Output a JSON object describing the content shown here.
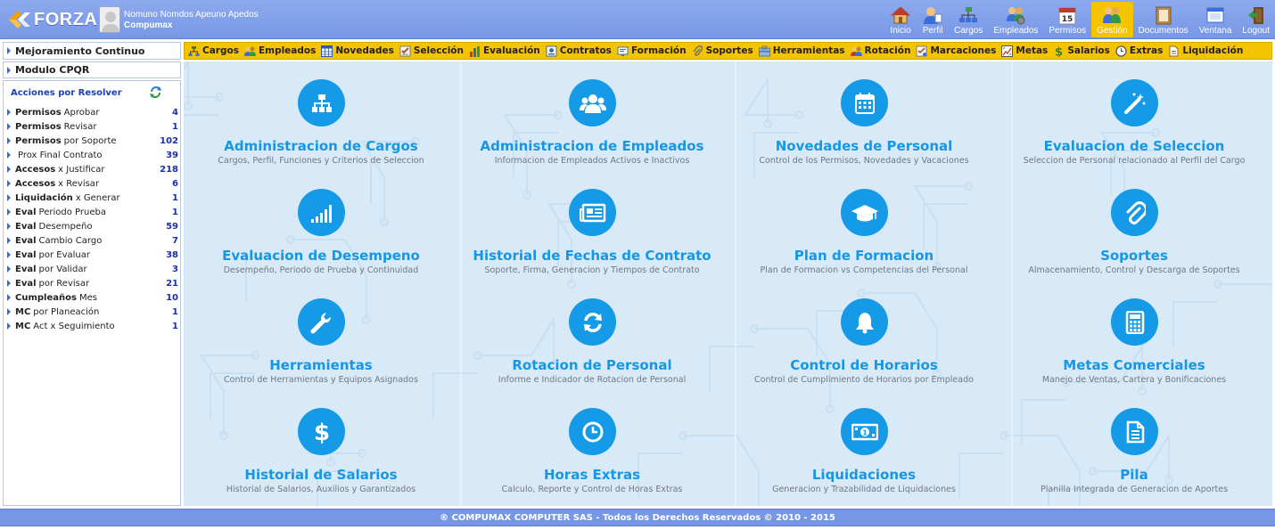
{
  "header": {
    "brand": "FORZA",
    "user_name": "Nomuno Nomdos Apeuno Apedos",
    "company": "Compumax",
    "nav": [
      {
        "label": "Inicio",
        "icon": "home-icon"
      },
      {
        "label": "Perfil",
        "icon": "user-profile-icon"
      },
      {
        "label": "Cargos",
        "icon": "org-chart-icon"
      },
      {
        "label": "Empleados",
        "icon": "employees-icon"
      },
      {
        "label": "Permisos",
        "icon": "calendar-icon"
      },
      {
        "label": "Gestión",
        "icon": "people-management-icon",
        "active": true
      },
      {
        "label": "Documentos",
        "icon": "documents-icon"
      },
      {
        "label": "Ventana",
        "icon": "window-icon"
      },
      {
        "label": "Logout",
        "icon": "logout-icon"
      }
    ]
  },
  "sidebar": {
    "mejoramiento": "Mejoramiento Continuo",
    "modulo": "Modulo CPQR",
    "acciones_title": "Acciones por Resolver",
    "items": [
      {
        "bold": "Permisos",
        "text": "Aprobar",
        "count": "4"
      },
      {
        "bold": "Permisos",
        "text": "Revisar",
        "count": "1"
      },
      {
        "bold": "Permisos",
        "text": "por Soporte",
        "count": "102"
      },
      {
        "bold": "",
        "text": "Prox Final Contrato",
        "count": "39"
      },
      {
        "bold": "Accesos",
        "text": "x Justificar",
        "count": "218"
      },
      {
        "bold": "Accesos",
        "text": "x Revisar",
        "count": "6"
      },
      {
        "bold": "Liquidación",
        "text": "x Generar",
        "count": "1"
      },
      {
        "bold": "Eval",
        "text": "Periodo Prueba",
        "count": "1"
      },
      {
        "bold": "Eval",
        "text": "Desempeño",
        "count": "59"
      },
      {
        "bold": "Eval",
        "text": "Cambio Cargo",
        "count": "7"
      },
      {
        "bold": "Eval",
        "text": "por Evaluar",
        "count": "38"
      },
      {
        "bold": "Eval",
        "text": "por Validar",
        "count": "3"
      },
      {
        "bold": "Eval",
        "text": "por Revisar",
        "count": "21"
      },
      {
        "bold": "Cumpleaños",
        "text": "Mes",
        "count": "10"
      },
      {
        "bold": "MC",
        "text": "por Planeación",
        "count": "1"
      },
      {
        "bold": "MC",
        "text": "Act x Seguimiento",
        "count": "1"
      }
    ]
  },
  "modules": [
    {
      "label": "Cargos",
      "icon": "org-chart-icon",
      "color": "#3c7d3c"
    },
    {
      "label": "Empleados",
      "icon": "employees-icon",
      "color": "#b8861b"
    },
    {
      "label": "Novedades",
      "icon": "grid-calendar-icon",
      "color": "#3355aa"
    },
    {
      "label": "Selección",
      "icon": "checklist-icon",
      "color": "#b84a2a"
    },
    {
      "label": "Evaluación",
      "icon": "bar-chart-icon",
      "color": "#2a6cc4"
    },
    {
      "label": "Contratos",
      "icon": "contract-icon",
      "color": "#3a6ea8"
    },
    {
      "label": "Formación",
      "icon": "training-icon",
      "color": "#3a78b8"
    },
    {
      "label": "Soportes",
      "icon": "paperclip-icon",
      "color": "#666666"
    },
    {
      "label": "Herramientas",
      "icon": "tools-icon",
      "color": "#5a7a9a"
    },
    {
      "label": "Rotación",
      "icon": "rotation-icon",
      "color": "#b8861b"
    },
    {
      "label": "Marcaciones",
      "icon": "clock-card-icon",
      "color": "#b84a2a"
    },
    {
      "label": "Metas",
      "icon": "target-icon",
      "color": "#555555"
    },
    {
      "label": "Salarios",
      "icon": "dollar-icon",
      "color": "#2b8a2b"
    },
    {
      "label": "Extras",
      "icon": "clock-icon",
      "color": "#5a5a5a"
    },
    {
      "label": "Liquidación",
      "icon": "document-icon",
      "color": "#8a6a30"
    }
  ],
  "tiles": [
    {
      "title": "Administracion de Cargos",
      "desc": "Cargos, Perfil, Funciones y Criterios de Seleccion",
      "icon": "sitemap-icon"
    },
    {
      "title": "Administracion de Empleados",
      "desc": "Informacion de Empleados Activos e Inactivos",
      "icon": "users-icon"
    },
    {
      "title": "Novedades de Personal",
      "desc": "Control de los Permisos, Novedades y Vacaciones",
      "icon": "calendar-icon"
    },
    {
      "title": "Evaluacion de Seleccion",
      "desc": "Seleccion de Personal relacionado al Perfil del Cargo",
      "icon": "magic-wand-icon"
    },
    {
      "title": "Evaluacion de Desempeno",
      "desc": "Desempeño, Periodo de Prueba y Continuidad",
      "icon": "signal-bars-icon"
    },
    {
      "title": "Historial de Fechas de Contrato",
      "desc": "Soporte, Firma, Generacion y Tiempos de Contrato",
      "icon": "newspaper-icon"
    },
    {
      "title": "Plan de Formacion",
      "desc": "Plan de Formacion vs Competencias del Personal",
      "icon": "graduation-cap-icon"
    },
    {
      "title": "Soportes",
      "desc": "Almacenamiento, Control y Descarga de Soportes",
      "icon": "paperclip-icon"
    },
    {
      "title": "Herramientas",
      "desc": "Control de Herramientas y Equipos Asignados",
      "icon": "wrench-icon"
    },
    {
      "title": "Rotacion de Personal",
      "desc": "Informe e Indicador de Rotacion de Personal",
      "icon": "refresh-icon"
    },
    {
      "title": "Control de Horarios",
      "desc": "Control de Cumplimiento de Horarios por Empleado",
      "icon": "bell-icon"
    },
    {
      "title": "Metas Comerciales",
      "desc": "Manejo de Ventas, Cartera y Bonificaciones",
      "icon": "calculator-icon"
    },
    {
      "title": "Historial de Salarios",
      "desc": "Historial de Salarios, Auxilios y Garantizados",
      "icon": "dollar-icon"
    },
    {
      "title": "Horas Extras",
      "desc": "Calculo, Reporte y Control de Horas Extras",
      "icon": "clock-icon"
    },
    {
      "title": "Liquidaciones",
      "desc": "Generacion y Trazabilidad de Liquidaciones",
      "icon": "banknote-icon"
    },
    {
      "title": "Pila",
      "desc": "Planilla Integrada de Generacion de Aportes",
      "icon": "file-text-icon"
    }
  ],
  "footer": "® COMPUMAX COMPUTER SAS - Todos los Derechos Reservados © 2010 - 2015"
}
